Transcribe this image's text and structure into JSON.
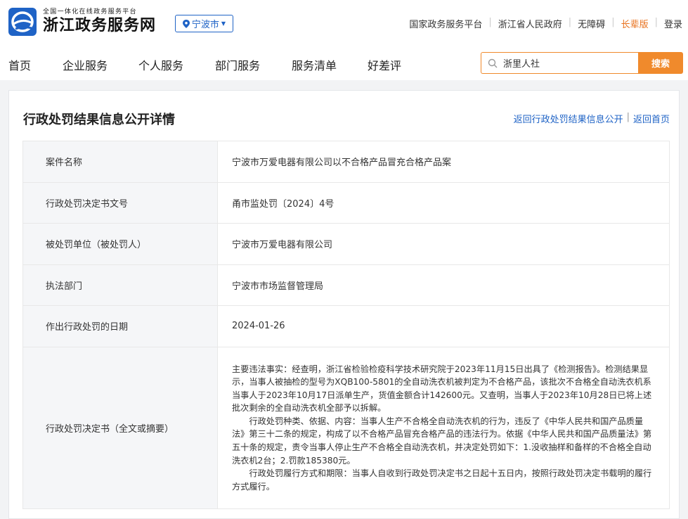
{
  "header": {
    "logo_subtitle": "全国一体化在线政务服务平台",
    "logo_title": "浙江政务服务网",
    "city": "宁波市",
    "top_links": [
      {
        "label": "国家政务服务平台"
      },
      {
        "label": "浙江省人民政府"
      },
      {
        "label": "无障碍"
      },
      {
        "label": "长辈版"
      },
      {
        "label": "登录"
      }
    ]
  },
  "nav": {
    "items": [
      "首页",
      "企业服务",
      "个人服务",
      "部门服务",
      "服务清单",
      "好差评"
    ],
    "search_value": "浙里人社",
    "search_button": "搜索"
  },
  "page": {
    "title": "行政处罚结果信息公开详情",
    "back_link": "返回行政处罚结果信息公开",
    "home_link": "返回首页"
  },
  "rows": [
    {
      "label": "案件名称",
      "value": "宁波市万爱电器有限公司以不合格产品冒充合格产品案"
    },
    {
      "label": "行政处罚决定书文号",
      "value": "甬市监处罚〔2024〕4号"
    },
    {
      "label": "被处罚单位（被处罚人）",
      "value": "宁波市万爱电器有限公司"
    },
    {
      "label": "执法部门",
      "value": "宁波市市场监督管理局"
    },
    {
      "label": "作出行政处罚的日期",
      "value": "2024-01-26"
    }
  ],
  "decision": {
    "label": "行政处罚决定书（全文或摘要）",
    "paragraphs": [
      "主要违法事实：经查明，浙江省检验检疫科学技术研究院于2023年11月15日出具了《检测报告》。检测结果显示，当事人被抽检的型号为XQB100-5801的全自动洗衣机被判定为不合格产品，该批次不合格全自动洗衣机系当事人于2023年10月17日派单生产，货值金额合计142600元。又查明，当事人于2023年10月28日已将上述批次剩余的全自动洗衣机全部予以拆解。",
      "行政处罚种类、依据、内容：当事人生产不合格全自动洗衣机的行为，违反了《中华人民共和国产品质量法》第三十二条的规定，构成了以不合格产品冒充合格产品的违法行为。依据《中华人民共和国产品质量法》第五十条的规定，责令当事人停止生产不合格全自动洗衣机，并决定处罚如下：1.没收抽样和备样的不合格全自动洗衣机2台；2.罚款185380元。",
      "行政处罚履行方式和期限：当事人自收到行政处罚决定书之日起十五日内，按照行政处罚决定书载明的履行方式履行。"
    ]
  },
  "colors": {
    "brand_blue": "#1f63c6",
    "accent_orange": "#f08a2c",
    "elder_orange": "#e8721f"
  }
}
